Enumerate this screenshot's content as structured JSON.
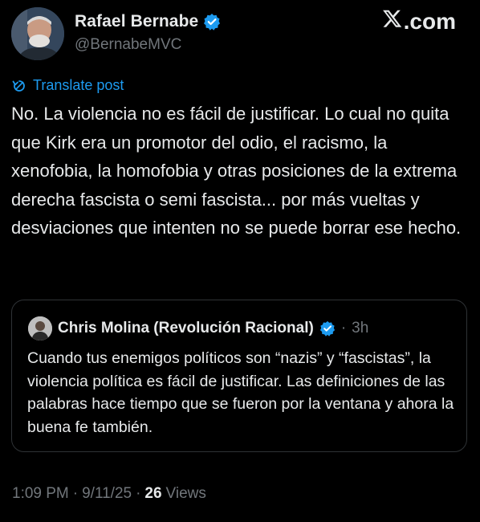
{
  "author": {
    "display_name": "Rafael Bernabe",
    "handle": "@BernabeMVC",
    "verified": true
  },
  "brand": {
    "label": ".com",
    "icon": "x-logo-icon"
  },
  "translate": {
    "label": "Translate post",
    "icon": "translate-icon"
  },
  "post": {
    "text": "No. La violencia no es fácil de justificar. Lo cual no quita que Kirk era un promotor del odio, el racismo, la xenofobia, la homofobia y otras posiciones de la extrema derecha fascista o semi fascista... por más vueltas y desviaciones que intenten no se puede borrar ese hecho."
  },
  "quote": {
    "display_name": "Chris Molina (Revolución Racional)",
    "separator": "·",
    "time": "3h",
    "text": "Cuando tus enemigos políticos son “nazis” y “fascistas”, la violencia política es fácil de justificar. Las definiciones de las palabras hace tiempo que se fueron por la ventana y ahora la buena fe también."
  },
  "footer": {
    "time": "1:09 PM",
    "sep1": "·",
    "date": "9/11/25",
    "sep2": "·",
    "views_count": "26",
    "views_label": "Views"
  },
  "colors": {
    "background": "#000000",
    "text": "#e7e9ea",
    "muted": "#71767b",
    "link": "#1d9bf0",
    "verified": "#1d9bf0",
    "border": "#2f3336"
  }
}
